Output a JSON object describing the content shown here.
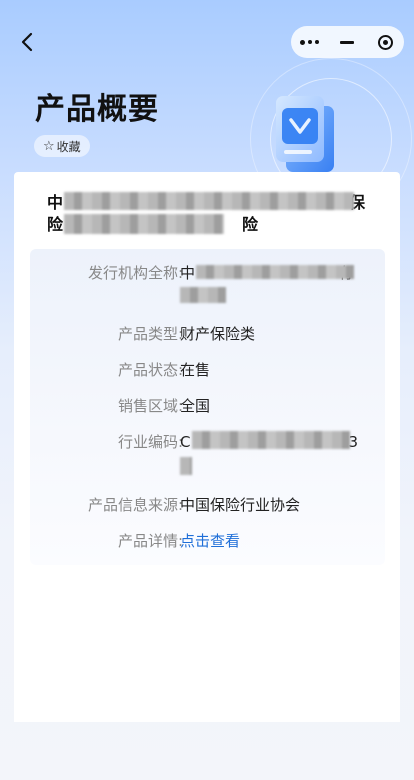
{
  "nav": {
    "back_icon": "chevron-left-icon"
  },
  "capsule": {
    "more_icon": "more-dots-icon",
    "minimize_icon": "minus-icon",
    "close_icon": "target-circle-icon"
  },
  "header": {
    "title": "产品概要",
    "favorite_label": "收藏",
    "favorite_icon": "star-outline-icon"
  },
  "product": {
    "name_visible_parts": [
      "中",
      "保",
      "险",
      "险"
    ]
  },
  "info": {
    "rows": [
      {
        "label": "发行机构全称:",
        "value_prefix": "中",
        "value_suffix": "有"
      },
      {
        "label": "产品类型:",
        "value": "财产保险类"
      },
      {
        "label": "产品状态:",
        "value": "在售"
      },
      {
        "label": "销售区域:",
        "value": "全国"
      },
      {
        "label": "行业编码:",
        "value_prefix": "C",
        "value_suffix": "93"
      },
      {
        "label": "产品信息来源:",
        "value": "中国保险行业协会"
      },
      {
        "label": "产品详情:",
        "value": "点击查看"
      }
    ]
  },
  "colors": {
    "link": "#1f6fd8",
    "label": "#888888",
    "accent_blue": "#3b8bff"
  }
}
